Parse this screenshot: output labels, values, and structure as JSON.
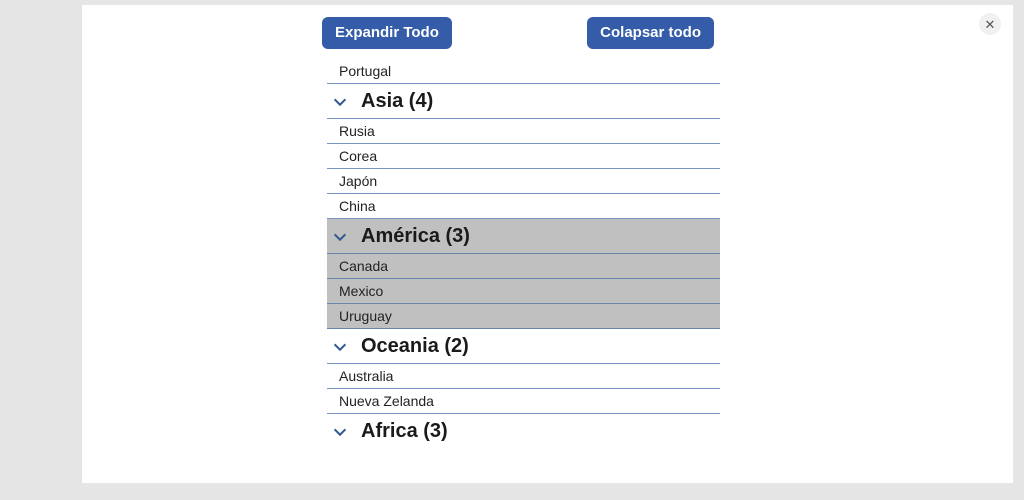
{
  "toolbar": {
    "expand_label": "Expandir Todo",
    "collapse_label": "Colapsar todo"
  },
  "close_glyph": "✕",
  "visible_first_item": "Portugal",
  "groups": [
    {
      "id": "asia",
      "title": "Asia (4)",
      "highlight": false,
      "items": [
        "Rusia",
        "Corea",
        "Japón",
        "China"
      ]
    },
    {
      "id": "america",
      "title": "América (3)",
      "highlight": true,
      "items": [
        "Canada",
        "Mexico",
        "Uruguay"
      ]
    },
    {
      "id": "oceania",
      "title": "Oceania (2)",
      "highlight": false,
      "items": [
        "Australia",
        "Nueva Zelanda"
      ]
    },
    {
      "id": "africa",
      "title": "Africa (3)",
      "highlight": false,
      "items": []
    }
  ]
}
